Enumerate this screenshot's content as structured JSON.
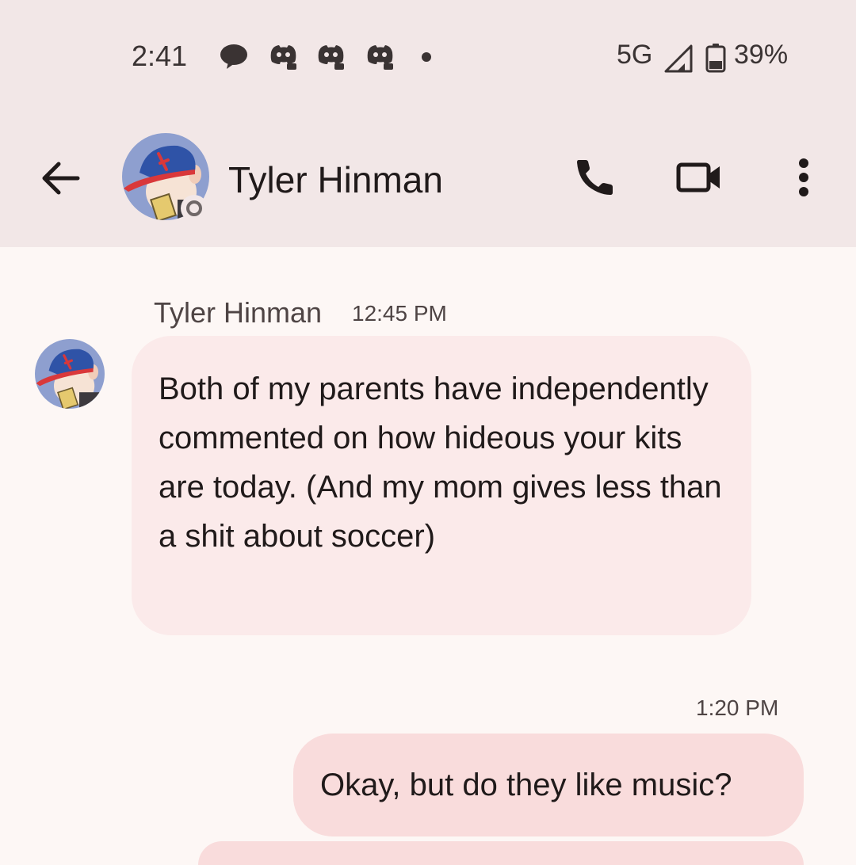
{
  "status_bar": {
    "time": "2:41",
    "network": "5G",
    "battery": "39%",
    "notification_icons": [
      "chat-bubble-icon",
      "discord-icon",
      "discord-icon",
      "discord-icon",
      "more-notifications-dot"
    ]
  },
  "header": {
    "contact_name": "Tyler Hinman",
    "actions": [
      "back-arrow-icon",
      "phone-icon",
      "video-camera-icon",
      "more-vert-icon"
    ]
  },
  "messages": [
    {
      "direction": "incoming",
      "sender": "Tyler Hinman",
      "time": "12:45 PM",
      "text": "Both of my parents have independently commented on how hideous your kits are today. (And my mom gives less than a shit about soccer)"
    },
    {
      "direction": "outgoing",
      "time": "1:20 PM",
      "text": "Okay, but do they like music?"
    }
  ],
  "colors": {
    "top_bar": "#f2e7e7",
    "background": "#fdf7f5",
    "incoming_bubble": "#fbeaea",
    "outgoing_bubble": "#f9dcdc"
  }
}
